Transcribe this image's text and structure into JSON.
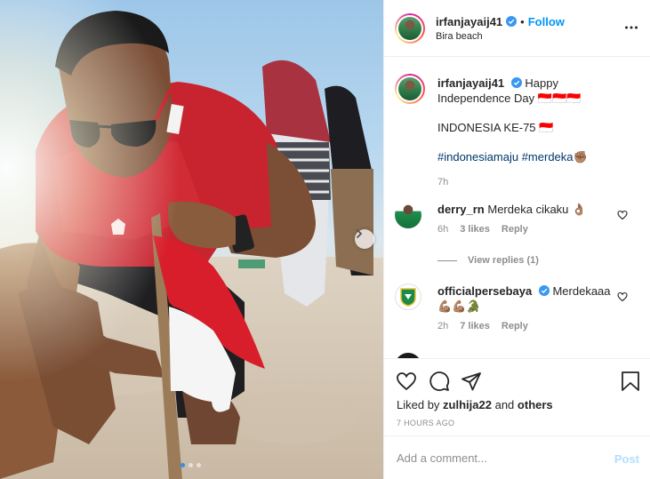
{
  "post": {
    "username": "irfanjayaij41",
    "follow_label": "Follow",
    "bullet": "•",
    "location": "Bira beach"
  },
  "caption": {
    "username": "irfanjayaij41",
    "text_line1": "Happy Independence",
    "text_line2": "Day 🇮🇩🇮🇩🇮🇩",
    "text_line3": "INDONESIA KE-75 🇮🇩",
    "hashtag1": "#indonesiamaju",
    "hashtag2": "#merdeka",
    "hashtag_emoji": "✊🏽",
    "time": "7h"
  },
  "comments": [
    {
      "username": "derry_rn",
      "text": "Merdeka cikaku 👌🏽",
      "time": "6h",
      "likes": "3 likes",
      "reply_label": "Reply",
      "view_replies": "View replies (1)"
    },
    {
      "username": "officialpersebaya",
      "text": "Merdekaaa",
      "text_line2": "💪🏽💪🏽🐊",
      "time": "2h",
      "likes": "7 likes",
      "reply_label": "Reply"
    }
  ],
  "footer": {
    "liked_by_prefix": "Liked by",
    "liked_by_user": "zulhija22",
    "liked_by_and": "and",
    "liked_by_others": "others",
    "time_ago": "7 HOURS AGO"
  },
  "add_comment": {
    "placeholder": "Add a comment...",
    "post_label": "Post"
  },
  "colors": {
    "link_blue": "#0095f6",
    "hashtag_navy": "#00376b",
    "post_disabled": "#b2dffc",
    "meta_gray": "#8e8e8e"
  },
  "icons": {
    "verified": "verified-badge-icon",
    "more": "more-options-icon",
    "like": "heart-icon",
    "comment": "comment-bubble-icon",
    "share": "paper-plane-icon",
    "save": "bookmark-icon",
    "next": "chevron-right-icon"
  },
  "carousel": {
    "slides": 3,
    "active": 1
  }
}
